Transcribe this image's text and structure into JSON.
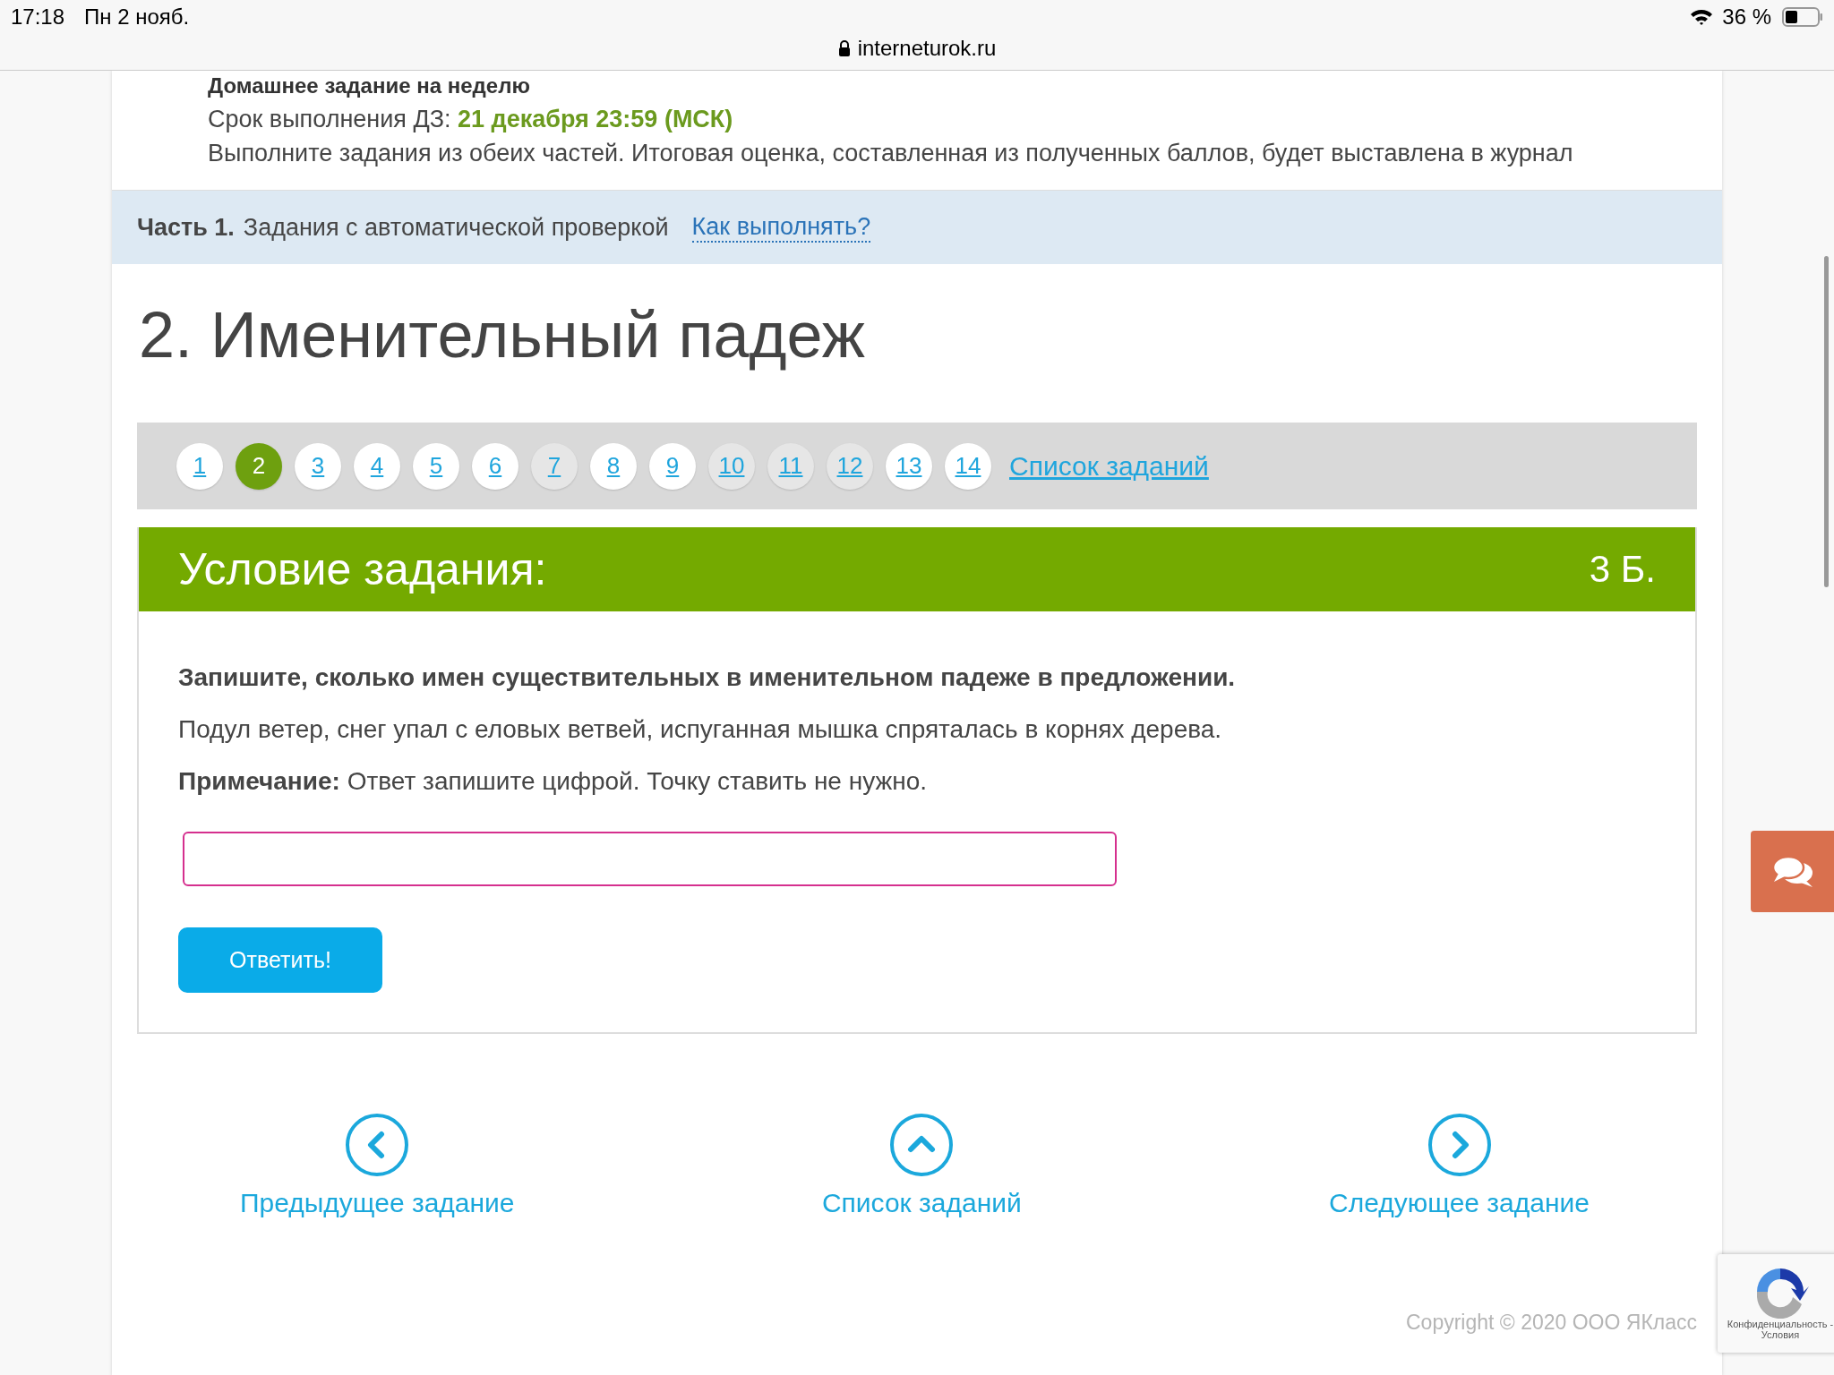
{
  "status_bar": {
    "time": "17:18",
    "date": "Пн 2 нояб.",
    "battery_percent": "36 %"
  },
  "address_bar": {
    "url": "interneturok.ru"
  },
  "homework": {
    "title": "Домашнее задание на неделю",
    "deadline_label": "Срок выполнения ДЗ:",
    "deadline": "21 декабря 23:59 (МСК)",
    "note": "Выполните задания из обеих частей. Итоговая оценка, составленная из полученных баллов, будет выставлена в журнал"
  },
  "part": {
    "label": "Часть 1.",
    "text": "Задания с автоматической проверкой",
    "help_link": "Как выполнять?"
  },
  "task_title": "2. Именительный падеж",
  "pagination": {
    "pages": [
      {
        "label": "1",
        "selected": false,
        "visited": false
      },
      {
        "label": "2",
        "selected": true,
        "visited": false
      },
      {
        "label": "3",
        "selected": false,
        "visited": false
      },
      {
        "label": "4",
        "selected": false,
        "visited": false
      },
      {
        "label": "5",
        "selected": false,
        "visited": false
      },
      {
        "label": "6",
        "selected": false,
        "visited": false
      },
      {
        "label": "7",
        "selected": false,
        "visited": true
      },
      {
        "label": "8",
        "selected": false,
        "visited": false
      },
      {
        "label": "9",
        "selected": false,
        "visited": false
      },
      {
        "label": "10",
        "selected": false,
        "visited": true
      },
      {
        "label": "11",
        "selected": false,
        "visited": true
      },
      {
        "label": "12",
        "selected": false,
        "visited": true
      },
      {
        "label": "13",
        "selected": false,
        "visited": false
      },
      {
        "label": "14",
        "selected": false,
        "visited": false
      }
    ],
    "list_link": "Список заданий"
  },
  "task": {
    "header": "Условие задания:",
    "points": "3 Б.",
    "question": "Запишите, сколько имен существительных в именительном падеже в предложении.",
    "sentence": "Подул ветер, снег упал с еловых ветвей, испуганная мышка спряталась в корнях дерева.",
    "note": "**Примечание:** Ответ запишите цифрой. Точку ставить не нужно.",
    "submit": "Ответить!"
  },
  "navigation": [
    {
      "kind": "prev",
      "label": "Предыдущее задание"
    },
    {
      "kind": "up",
      "label": "Список заданий"
    },
    {
      "kind": "next",
      "label": "Следующее задание"
    }
  ],
  "copyright": "Copyright © 2020 ООО ЯКласс",
  "recaptcha": {
    "text": "Конфиденциальность - Условия"
  }
}
